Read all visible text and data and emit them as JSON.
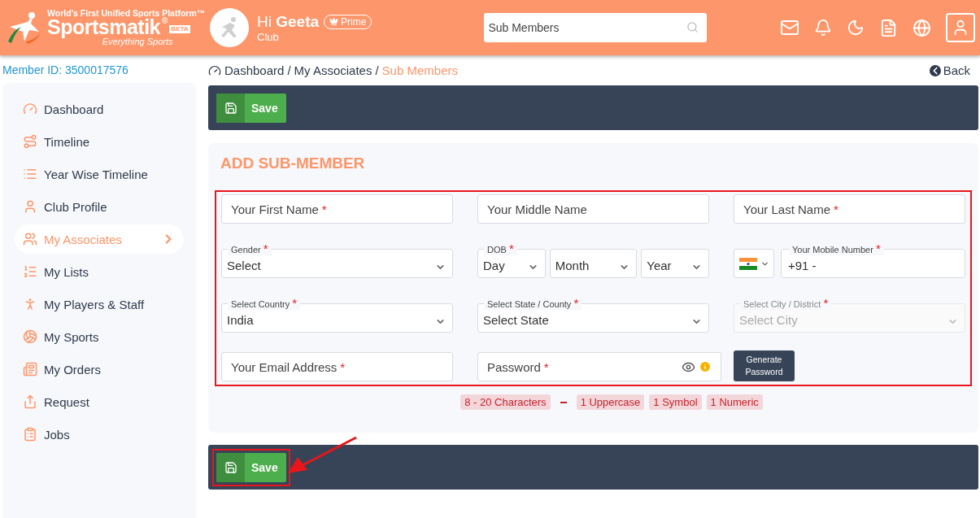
{
  "header": {
    "logo": {
      "tagline": "World’s First Unified Sports Platform™",
      "name": "Sportsmatik",
      "reg": "®",
      "beta": "BETA",
      "slogan": "Everything Sports"
    },
    "greeting": {
      "hi": "Hi",
      "name": "Geeta",
      "badge": "Prime",
      "role": "Club"
    },
    "search": {
      "value": "Sub Members"
    }
  },
  "member_id": "Member ID: 3500017576",
  "sidebar": {
    "items": [
      {
        "label": "Dashboard",
        "selected": false
      },
      {
        "label": "Timeline",
        "selected": false
      },
      {
        "label": "Year Wise Timeline",
        "selected": false
      },
      {
        "label": "Club Profile",
        "selected": false
      },
      {
        "label": "My Associates",
        "selected": true
      },
      {
        "label": "My Lists",
        "selected": false
      },
      {
        "label": "My Players & Staff",
        "selected": false
      },
      {
        "label": "My Sports",
        "selected": false
      },
      {
        "label": "My Orders",
        "selected": false
      },
      {
        "label": "Request",
        "selected": false
      },
      {
        "label": "Jobs",
        "selected": false
      }
    ]
  },
  "breadcrumb": {
    "separator": "/",
    "items": [
      {
        "label": "Dashboard",
        "current": false
      },
      {
        "label": "My Associates",
        "current": false
      },
      {
        "label": "Sub Members",
        "current": true
      }
    ],
    "back": "Back"
  },
  "top_toolbar": {
    "save": "Save"
  },
  "form": {
    "title": "ADD SUB-MEMBER",
    "required_mark": "*",
    "highlighted": true,
    "fields": [
      {
        "kind": "text",
        "placeholder": "Your First Name",
        "required": true
      },
      {
        "kind": "text",
        "placeholder": "Your Middle Name",
        "required": false
      },
      {
        "kind": "text",
        "placeholder": "Your Last Name",
        "required": true
      },
      {
        "kind": "select",
        "label": "Gender",
        "value": "Select",
        "required": true,
        "disabled": false
      },
      {
        "kind": "dob",
        "label": "DOB",
        "required": true,
        "parts": [
          "Day",
          "Month",
          "Year"
        ]
      },
      {
        "kind": "phone",
        "label": "Your Mobile Number",
        "value": "+91 -",
        "required": true
      },
      {
        "kind": "select",
        "label": "Select Country",
        "value": "India",
        "required": true,
        "disabled": false
      },
      {
        "kind": "select",
        "label": "Select State / County",
        "value": "Select State",
        "required": true,
        "disabled": false
      },
      {
        "kind": "select",
        "label": "Select City / District",
        "value": "Select City",
        "required": true,
        "disabled": true
      },
      {
        "kind": "text",
        "placeholder": "Your Email Address",
        "required": true
      },
      {
        "kind": "password",
        "placeholder": "Password",
        "required": true
      },
      {
        "kind": "button",
        "label": "Generate Password"
      }
    ],
    "rules": [
      {
        "kind": "tag",
        "text": "8 - 20 Characters"
      },
      {
        "kind": "dash"
      },
      {
        "kind": "tag",
        "text": "1 Uppercase"
      },
      {
        "kind": "tag",
        "text": "1 Symbol"
      },
      {
        "kind": "tag",
        "text": "1 Numeric"
      }
    ]
  },
  "bottom_toolbar": {
    "save": "Save",
    "highlighted": true,
    "arrow": true
  }
}
